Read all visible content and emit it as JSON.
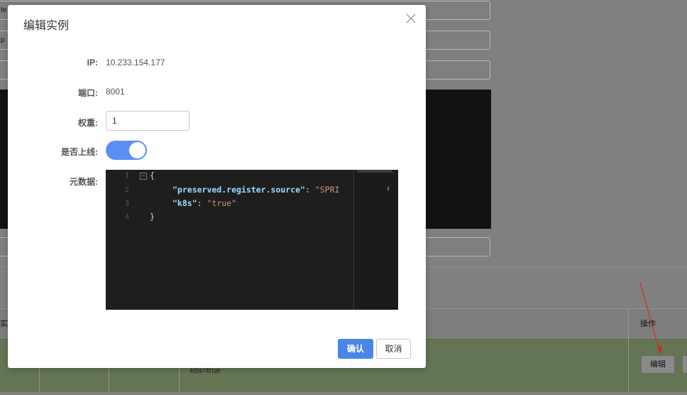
{
  "background": {
    "input_fragments": [
      "te",
      "p",
      ""
    ],
    "table": {
      "col_fragment": "实",
      "action_header": "操作",
      "metadata_cell": "k8s=true",
      "edit_button": "编辑"
    }
  },
  "modal": {
    "title": "编辑实例",
    "fields": {
      "ip_label": "IP:",
      "ip_value": "10.233.154.177",
      "port_label": "端口:",
      "port_value": "8001",
      "weight_label": "权重:",
      "weight_value": "1",
      "online_label": "是否上线:",
      "online_enabled": true,
      "metadata_label": "元数据:"
    },
    "editor": {
      "line_numbers": [
        "1",
        "2",
        "3",
        "4"
      ],
      "lines": [
        {
          "text": "{"
        },
        {
          "key": "\"preserved.register.source\"",
          "sep": ": ",
          "value": "\"SPRI"
        },
        {
          "key": "\"k8s\"",
          "sep": ": ",
          "value": "\"true\""
        },
        {
          "text": "}"
        }
      ]
    },
    "confirm_label": "确认",
    "cancel_label": "取消"
  },
  "colors": {
    "primary": "#4a86e8",
    "toggle_on": "#5b8ef3",
    "editor_bg": "#1e1e1e",
    "json_key": "#9cdcfe",
    "json_string": "#ce9178"
  }
}
